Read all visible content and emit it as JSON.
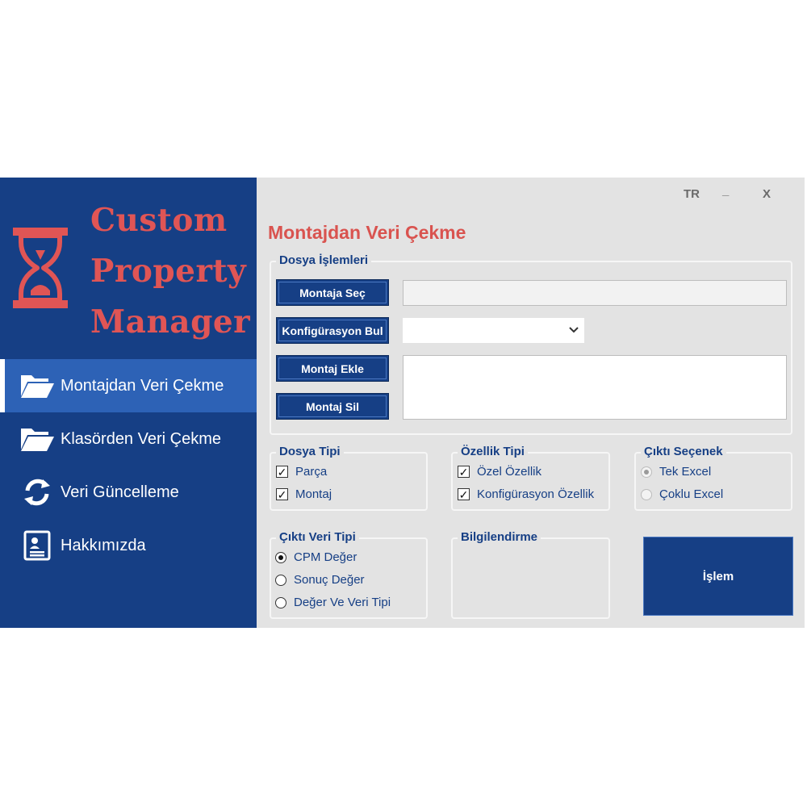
{
  "window": {
    "lang_label": "TR",
    "minimize_label": "_",
    "close_label": "X"
  },
  "logo": {
    "line1": "Custom",
    "line2": "Property",
    "line3": "Manager",
    "icon": "hourglass-icon"
  },
  "sidebar": {
    "items": [
      {
        "label": "Montajdan Veri Çekme",
        "icon": "folder-open-icon",
        "active": true
      },
      {
        "label": "Klasörden Veri Çekme",
        "icon": "folder-open-icon",
        "active": false
      },
      {
        "label": "Veri Güncelleme",
        "icon": "refresh-icon",
        "active": false
      },
      {
        "label": "Hakkımızda",
        "icon": "contact-card-icon",
        "active": false
      }
    ]
  },
  "main": {
    "title": "Montajdan Veri Çekme",
    "file_ops": {
      "title": "Dosya İşlemleri",
      "select_label": "Montaja Seç",
      "config_label": "Konfigürasyon Bul",
      "add_label": "Montaj Ekle",
      "remove_label": "Montaj Sil",
      "path_value": "",
      "config_value": "",
      "list_value": ""
    },
    "file_type": {
      "title": "Dosya Tipi",
      "options": [
        {
          "label": "Parça",
          "checked": true
        },
        {
          "label": "Montaj",
          "checked": true
        }
      ]
    },
    "prop_type": {
      "title": "Özellik Tipi",
      "options": [
        {
          "label": "Özel Özellik",
          "checked": true
        },
        {
          "label": "Konfigürasyon Özellik",
          "checked": true
        }
      ]
    },
    "output_choice": {
      "title": "Çıktı Seçenek",
      "options": [
        {
          "label": "Tek Excel",
          "selected": true
        },
        {
          "label": "Çoklu Excel",
          "selected": false
        }
      ]
    },
    "output_data": {
      "title": "Çıktı Veri Tipi",
      "options": [
        {
          "label": "CPM Değer",
          "selected": true
        },
        {
          "label": "Sonuç Değer",
          "selected": false
        },
        {
          "label": "Değer Ve Veri Tipi",
          "selected": false
        }
      ]
    },
    "info": {
      "title": "Bilgilendirme"
    },
    "run_label": "İşlem"
  },
  "colors": {
    "sidebar": "#163f85",
    "active_item": "#2d62b6",
    "accent": "#d9534f",
    "panel": "#e3e3e3"
  }
}
